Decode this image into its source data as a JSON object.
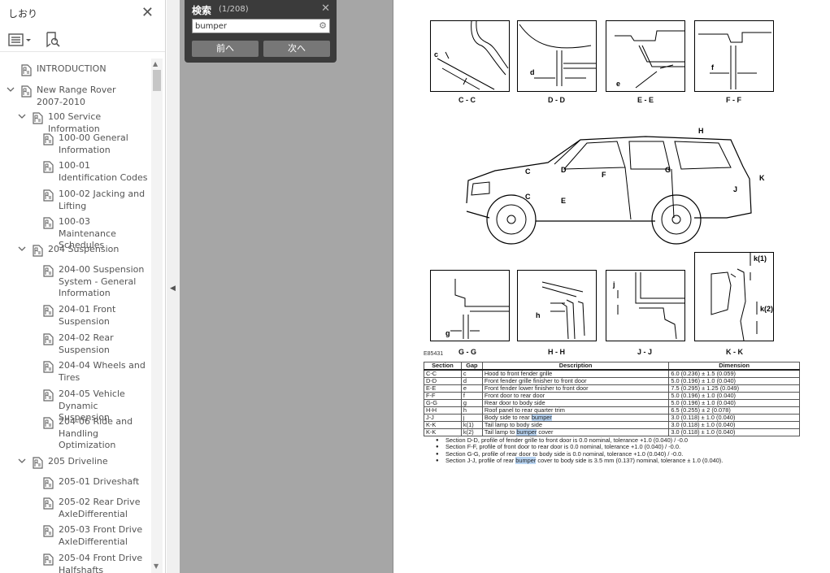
{
  "sidebar": {
    "title": "しおり",
    "bookmarks": [
      {
        "label": "INTRODUCTION"
      },
      {
        "label": "New Range Rover 2007-2010"
      },
      {
        "label": "100 Service Information"
      },
      {
        "label": "100-00 General Information"
      },
      {
        "label": "100-01 Identification Codes"
      },
      {
        "label": "100-02 Jacking and Lifting"
      },
      {
        "label": "100-03 Maintenance Schedules"
      },
      {
        "label": "204 Suspension"
      },
      {
        "label": "204-00 Suspension System - General Information"
      },
      {
        "label": "204-01 Front Suspension"
      },
      {
        "label": "204-02 Rear Suspension"
      },
      {
        "label": "204-04 Wheels and Tires"
      },
      {
        "label": "204-05 Vehicle Dynamic Suspension"
      },
      {
        "label": "204-06 Ride and Handling Optimization"
      },
      {
        "label": "205 Driveline"
      },
      {
        "label": "205-01 Driveshaft"
      },
      {
        "label": "205-02 Rear Drive AxleDifferential"
      },
      {
        "label": "205-03 Front Drive AxleDifferential"
      },
      {
        "label": "205-04 Front Drive Halfshafts"
      }
    ]
  },
  "search": {
    "title": "検索",
    "count": "(1/208)",
    "query": "bumper",
    "prev_label": "前へ",
    "next_label": "次へ"
  },
  "document": {
    "section_captions": {
      "cc": "C - C",
      "dd": "D - D",
      "ee": "E - E",
      "ff": "F - F",
      "gg": "G - G",
      "hh": "H - H",
      "jj": "J - J",
      "kk": "K - K"
    },
    "gap_letters": {
      "c": "c",
      "d": "d",
      "e": "e",
      "f": "f",
      "g": "g",
      "h": "h",
      "j": "j",
      "k1": "k(1)",
      "k2": "k(2)"
    },
    "car_labels": {
      "C": "C",
      "D": "D",
      "E": "E",
      "F": "F",
      "G": "G",
      "H": "H",
      "J": "J",
      "K": "K"
    },
    "figure_id": "E85431",
    "table": {
      "headers": [
        "Section",
        "Gap",
        "Description",
        "Dimension"
      ],
      "rows": [
        {
          "section": "C-C",
          "gap": "c",
          "desc_pre": "Hood to front fender grille",
          "desc_hl": "",
          "desc_post": "",
          "dim": "6.0 (0.236) ± 1.5 (0.059)"
        },
        {
          "section": "D-D",
          "gap": "d",
          "desc_pre": "Front fender grille finisher to front door",
          "desc_hl": "",
          "desc_post": "",
          "dim": "5.0 (0.196) ± 1.0 (0.040)"
        },
        {
          "section": "E-E",
          "gap": "e",
          "desc_pre": "Front fender lower finisher to front door",
          "desc_hl": "",
          "desc_post": "",
          "dim": "7.5 (0.295) ± 1.25 (0.049)"
        },
        {
          "section": "F-F",
          "gap": "f",
          "desc_pre": "Front door to rear door",
          "desc_hl": "",
          "desc_post": "",
          "dim": "5.0 (0.196) ± 1.0 (0.040)"
        },
        {
          "section": "G-G",
          "gap": "g",
          "desc_pre": "Rear door to body side",
          "desc_hl": "",
          "desc_post": "",
          "dim": "5.0 (0.196) ± 1.0 (0.040)"
        },
        {
          "section": "H-H",
          "gap": "h",
          "desc_pre": "Roof panel to rear quarter trim",
          "desc_hl": "",
          "desc_post": "",
          "dim": "6.5 (0.255) ± 2 (0.078)"
        },
        {
          "section": "J-J",
          "gap": "j",
          "desc_pre": "Body side to rear ",
          "desc_hl": "bumper",
          "desc_post": "",
          "dim": "3.0 (0.118) ± 1.0 (0.040)"
        },
        {
          "section": "K-K",
          "gap": "k(1)",
          "desc_pre": "Tail lamp to body side",
          "desc_hl": "",
          "desc_post": "",
          "dim": "3.0 (0.118) ± 1.0 (0.040)"
        },
        {
          "section": "K-K",
          "gap": "k(2)",
          "desc_pre": "Tail lamp to ",
          "desc_hl": "bumper",
          "desc_post": " cover",
          "dim": "3.0 (0.118) ± 1.0 (0.040)"
        }
      ]
    },
    "notes": [
      {
        "pre": "Section D-D, profile of fender grille to front door is 0.0 nominal, tolerance +1.0 (0.040) / -0.0",
        "hl": "",
        "post": ""
      },
      {
        "pre": "Section F-F, profile of front door to rear door is 0.0 nominal, tolerance +1.0 (0.040) / -0.0.",
        "hl": "",
        "post": ""
      },
      {
        "pre": "Section G-G, profile of rear door to body side is 0.0 nominal, tolerance +1.0 (0.040) / -0.0.",
        "hl": "",
        "post": ""
      },
      {
        "pre": "Section J-J, profile of rear ",
        "hl": "bumper",
        "post": " cover to body side is 3.5 mm (0.137) nominal, tolerance ± 1.0 (0.040)."
      }
    ]
  },
  "colors": {
    "search_bg": "#3b3b3b",
    "highlight": "#b9d5f3",
    "viewer_gray": "#a6a6a6"
  }
}
